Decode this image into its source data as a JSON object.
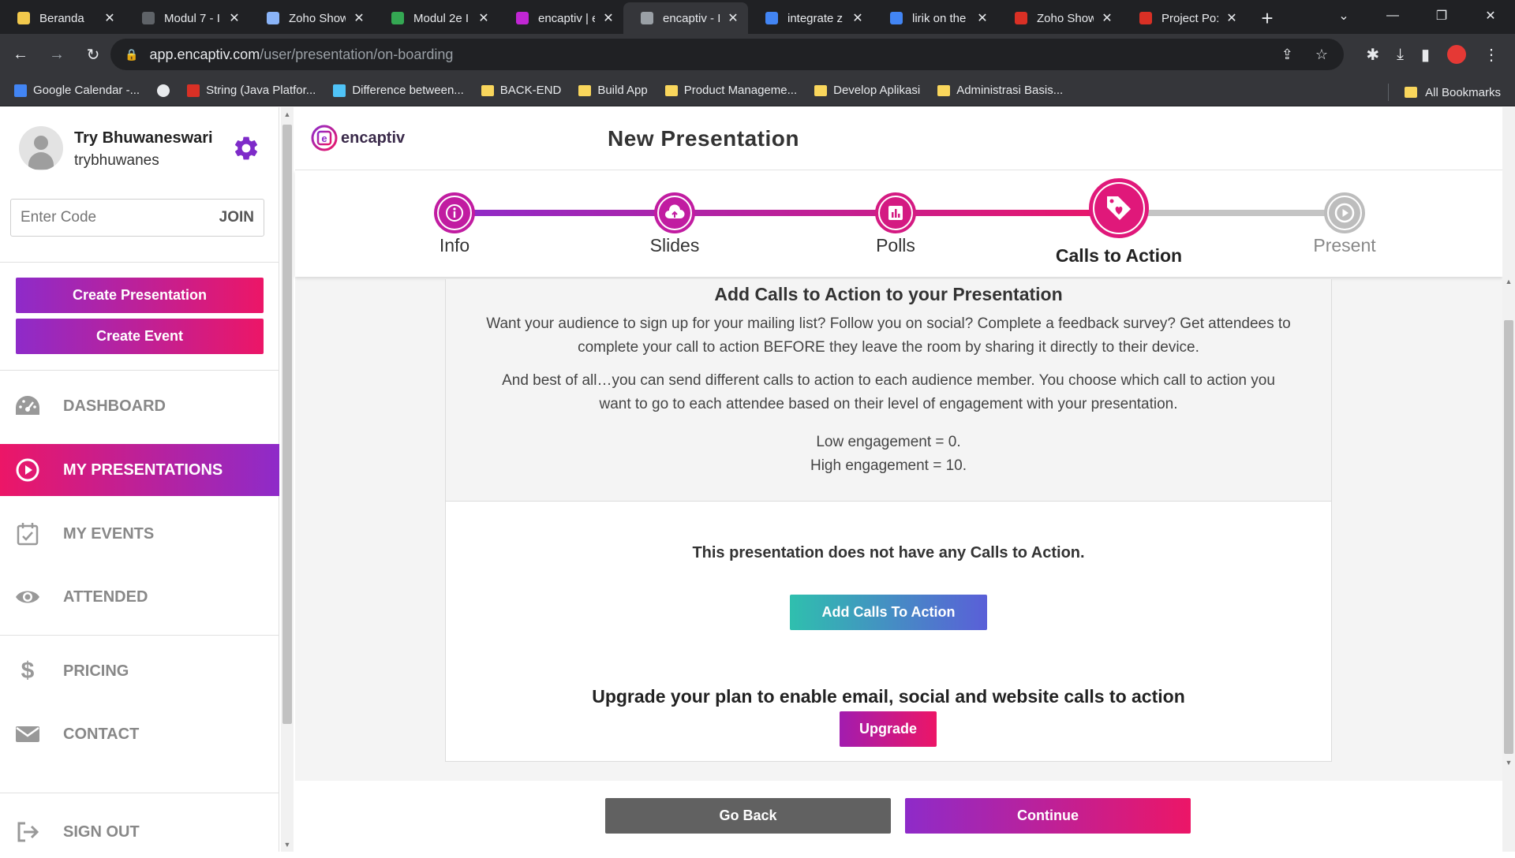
{
  "browser": {
    "tabs": [
      {
        "title": "Beranda",
        "fav_color": "#f2c94c",
        "active": false
      },
      {
        "title": "Modul 7 - I",
        "fav_color": "#5f6368",
        "active": false
      },
      {
        "title": "Zoho Show",
        "fav_color": "#8ab4f8",
        "active": false
      },
      {
        "title": "Modul 2e I",
        "fav_color": "#34a853",
        "active": false
      },
      {
        "title": "encaptiv | e",
        "fav_color": "#c026d3",
        "active": false
      },
      {
        "title": "encaptiv - I",
        "fav_color": "#9aa0a6",
        "active": true
      },
      {
        "title": "integrate z",
        "fav_color": "#4285f4",
        "active": false
      },
      {
        "title": "lirik on the",
        "fav_color": "#4285f4",
        "active": false
      },
      {
        "title": "Zoho Show",
        "fav_color": "#d93025",
        "active": false
      },
      {
        "title": "Project Po:",
        "fav_color": "#d93025",
        "active": false
      }
    ],
    "url_host": "app.encaptiv.com",
    "url_path": "/user/presentation/on-boarding",
    "bookmarks": [
      {
        "label": "Google Calendar -...",
        "kind": "calendar"
      },
      {
        "label": "",
        "kind": "globe"
      },
      {
        "label": "String (Java Platfor...",
        "kind": "oracle"
      },
      {
        "label": "Difference between...",
        "kind": "site"
      },
      {
        "label": "BACK-END",
        "kind": "folder"
      },
      {
        "label": "Build App",
        "kind": "folder"
      },
      {
        "label": "Product Manageme...",
        "kind": "folder"
      },
      {
        "label": "Develop Aplikasi",
        "kind": "folder"
      },
      {
        "label": "Administrasi Basis...",
        "kind": "folder"
      }
    ],
    "all_bookmarks": "All Bookmarks"
  },
  "sidebar": {
    "user_name": "Try Bhuwaneswari",
    "user_handle": "trybhuwanes",
    "code_placeholder": "Enter Code",
    "join_label": "JOIN",
    "create_presentation": "Create Presentation",
    "create_event": "Create Event",
    "nav": {
      "dashboard": "DASHBOARD",
      "my_presentations": "MY PRESENTATIONS",
      "my_events": "MY EVENTS",
      "attended": "ATTENDED",
      "pricing": "PRICING",
      "contact": "CONTACT",
      "sign_out": "SIGN OUT"
    }
  },
  "header": {
    "logo_text": "encaptiv",
    "page_title": "New Presentation"
  },
  "stepper": {
    "steps": [
      "Info",
      "Slides",
      "Polls",
      "Calls to Action",
      "Present"
    ],
    "current_step": "Calls to Action"
  },
  "content": {
    "heading": "Add Calls to Action to your Presentation",
    "para1": "Want your audience to sign up for your mailing list? Follow you on social? Complete a feedback survey? Get attendees to complete your call to action BEFORE they leave the room by sharing it directly to their device.",
    "para2": "And best of all…you can send different calls to action to each audience member. You choose which call to action you want to go to each attendee based on their level of engagement with your presentation.",
    "low_engagement": "Low engagement = 0.",
    "high_engagement": "High engagement = 10.",
    "empty_message": "This presentation does not have any Calls to Action.",
    "add_button": "Add Calls To Action",
    "upgrade_message": "Upgrade your plan to enable email, social and website calls to action",
    "upgrade_button": "Upgrade"
  },
  "footer": {
    "back_button": "Go Back",
    "continue_button": "Continue"
  },
  "colors": {
    "brand_purple": "#8e2bc9",
    "brand_pink": "#ec1667",
    "teal": "#2fbfae"
  }
}
